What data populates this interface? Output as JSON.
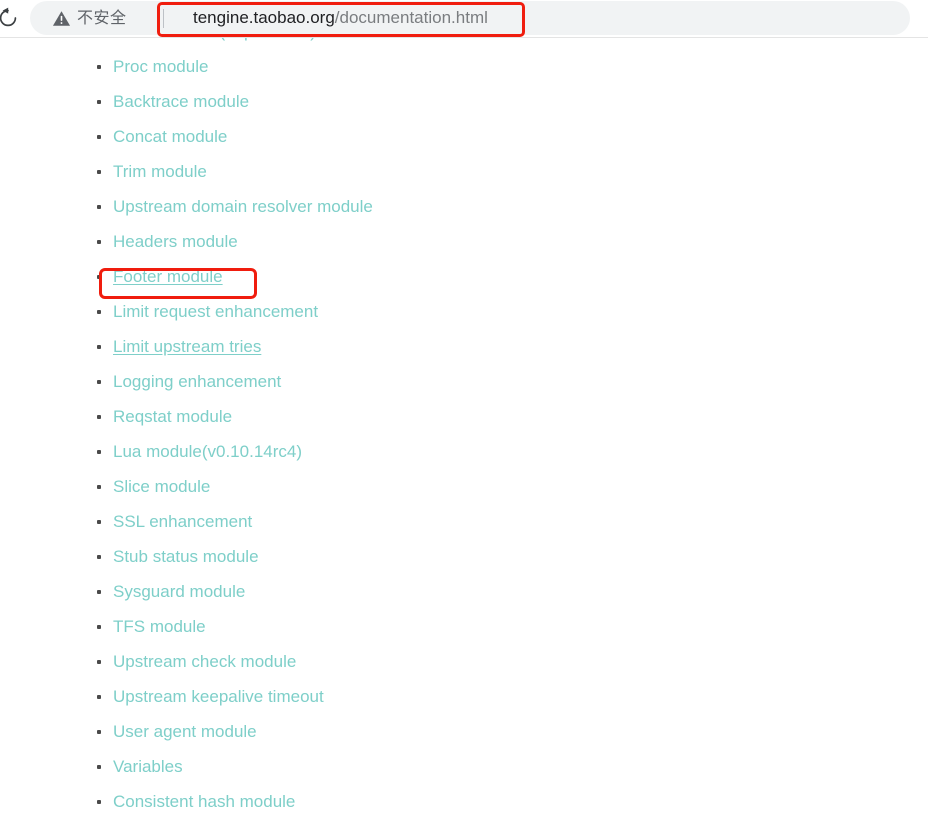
{
  "browser": {
    "reload_icon": "reload-icon",
    "security": {
      "icon": "warning-triangle-icon",
      "label": "不安全"
    },
    "url": {
      "host": "tengine.taobao.org",
      "path": "/documentation.html",
      "full": "tengine.taobao.org/documentation.html"
    }
  },
  "annotations": {
    "url_box_color": "#f01d0e",
    "footer_box_color": "#f01d0e"
  },
  "page": {
    "link_color": "#7ecfc9",
    "modules": [
      {
        "label": "SPDY module(deprecated)",
        "underlined": false,
        "highlighted": false
      },
      {
        "label": "Proc module",
        "underlined": false,
        "highlighted": false
      },
      {
        "label": "Backtrace module",
        "underlined": false,
        "highlighted": false
      },
      {
        "label": "Concat module",
        "underlined": false,
        "highlighted": false
      },
      {
        "label": "Trim module",
        "underlined": false,
        "highlighted": false
      },
      {
        "label": "Upstream domain resolver module",
        "underlined": false,
        "highlighted": false
      },
      {
        "label": "Headers module",
        "underlined": false,
        "highlighted": false
      },
      {
        "label": "Footer module",
        "underlined": true,
        "highlighted": true
      },
      {
        "label": "Limit request enhancement",
        "underlined": false,
        "highlighted": false
      },
      {
        "label": "Limit upstream tries",
        "underlined": true,
        "highlighted": false
      },
      {
        "label": "Logging enhancement",
        "underlined": false,
        "highlighted": false
      },
      {
        "label": "Reqstat module",
        "underlined": false,
        "highlighted": false
      },
      {
        "label": "Lua module(v0.10.14rc4)",
        "underlined": false,
        "highlighted": false
      },
      {
        "label": "Slice module",
        "underlined": false,
        "highlighted": false
      },
      {
        "label": "SSL enhancement",
        "underlined": false,
        "highlighted": false
      },
      {
        "label": "Stub status module",
        "underlined": false,
        "highlighted": false
      },
      {
        "label": "Sysguard module",
        "underlined": false,
        "highlighted": false
      },
      {
        "label": "TFS module",
        "underlined": false,
        "highlighted": false
      },
      {
        "label": "Upstream check module",
        "underlined": false,
        "highlighted": false
      },
      {
        "label": "Upstream keepalive timeout",
        "underlined": false,
        "highlighted": false
      },
      {
        "label": "User agent module",
        "underlined": false,
        "highlighted": false
      },
      {
        "label": "Variables",
        "underlined": false,
        "highlighted": false
      },
      {
        "label": "Consistent hash module",
        "underlined": false,
        "highlighted": false
      }
    ]
  }
}
